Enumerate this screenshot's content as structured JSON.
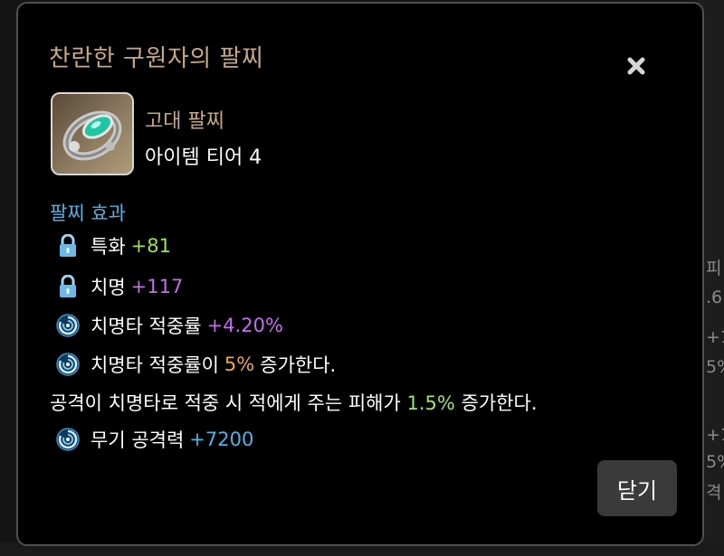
{
  "dialog": {
    "title": "찬란한 구원자의 팔찌",
    "item": {
      "grade": "고대 팔찌",
      "tier": "아이템 티어 4"
    },
    "effects_label": "팔찌 효과",
    "effects": [
      {
        "icon": "lock-icon",
        "label": "특화",
        "value": "+81"
      },
      {
        "icon": "lock-icon",
        "label": "치명",
        "value": "+117"
      },
      {
        "icon": "swirl-icon",
        "label": "치명타 적중률",
        "value": "+4.20%"
      },
      {
        "icon": "swirl-icon",
        "pre": "치명타 적중률이",
        "value": "5%",
        "post": "증가한다."
      }
    ],
    "description": {
      "pre": "공격이 치명타로 적중 시 적에게 주는 피해가",
      "value": "1.5%",
      "post": "증가한다."
    },
    "weapon_effect": {
      "icon": "swirl-icon",
      "label": "무기 공격력",
      "value": "+7200"
    },
    "close_label": "닫기",
    "colors": {
      "title": "#c9a884",
      "section": "#4fb3e6",
      "green": "#9be34f",
      "purple": "#c56cf0",
      "orange": "#f2a44b",
      "blue": "#4fb3e6"
    }
  },
  "background": {
    "peek_text": [
      "피",
      ".6",
      "+1",
      "5%",
      "+1",
      "5%",
      "격"
    ]
  }
}
